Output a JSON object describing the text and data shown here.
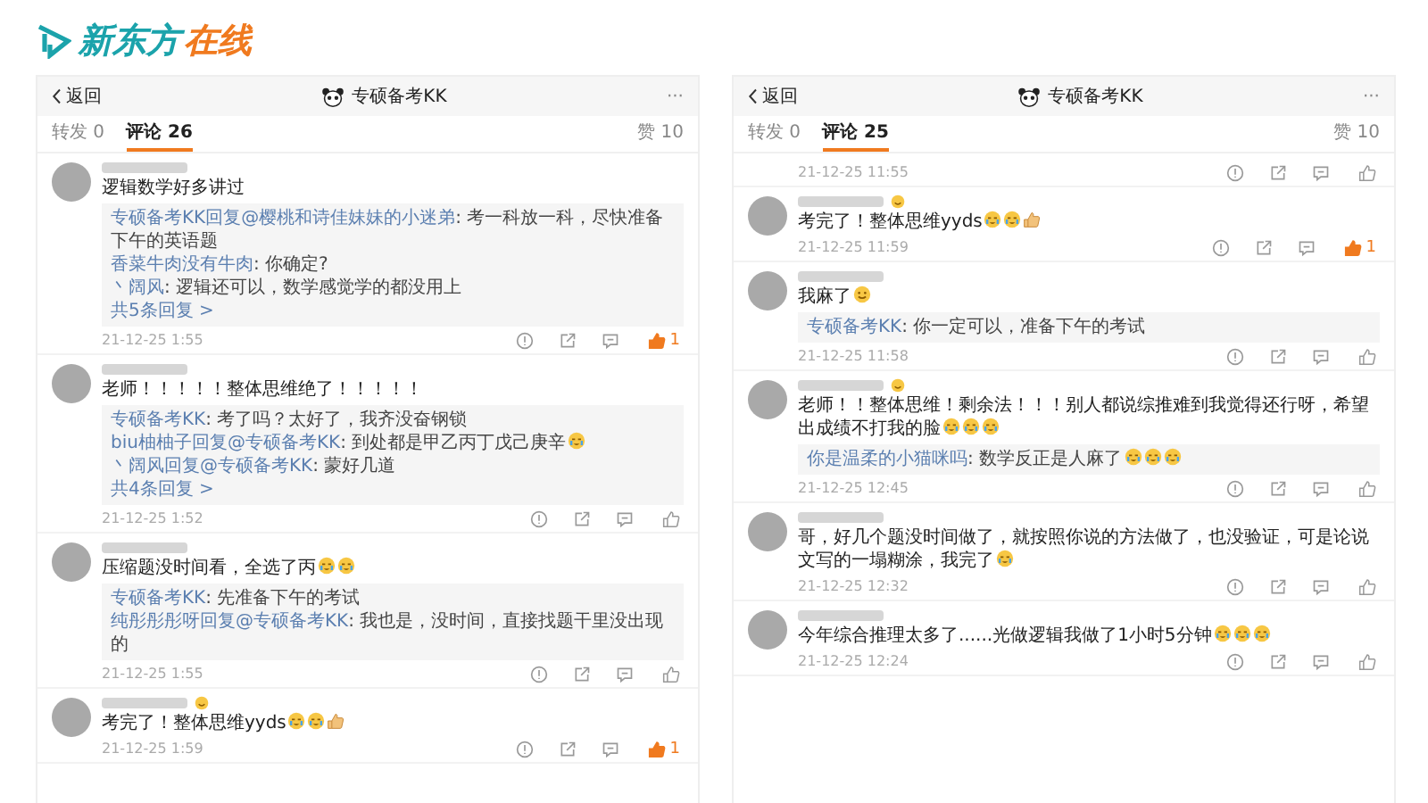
{
  "logo": {
    "parts": [
      {
        "text": "新东方",
        "color": "#1ba3ab"
      },
      {
        "text": "在线",
        "color": "#f07a1f"
      }
    ]
  },
  "phones": [
    {
      "back": "返回",
      "title": "专硕备考KK",
      "more": "···",
      "tabs": [
        {
          "label": "转发",
          "count": "0",
          "selected": false
        },
        {
          "label": "评论",
          "count": "26",
          "selected": true
        },
        {
          "label": "赞",
          "count": "10",
          "selected": false
        }
      ],
      "comments": [
        {
          "text": "逻辑数学好多讲过",
          "replies": [
            {
              "author": "专硕备考KK回复@樱桃和诗佳妹妹的小迷弟",
              "text": ": 考一科放一科，尽快准备下午的英语题"
            },
            {
              "author": "香菜牛肉没有牛肉",
              "text": ": 你确定?"
            },
            {
              "author": "丶阔风",
              "text": ": 逻辑还可以，数学感觉学的都没用上"
            }
          ],
          "more_replies": "共5条回复 >",
          "time": "21-12-25 1:55",
          "liked": true,
          "likes": "1"
        },
        {
          "text": "老师！！！！！整体思维绝了！！！！！",
          "replies": [
            {
              "author": "专硕备考KK",
              "text": ": 考了吗？太好了，我齐没奋钢锁"
            },
            {
              "author": "biu柚柚子回复@专硕备考KK",
              "text": ": 到处都是甲乙丙丁戊己庚辛",
              "emojis": [
                {
                  "kind": "cry"
                }
              ]
            },
            {
              "author": "丶阔风回复@专硕备考KK",
              "text": ": 蒙好几道"
            }
          ],
          "more_replies": "共4条回复 >",
          "time": "21-12-25 1:52",
          "liked": false
        },
        {
          "text": "压缩题没时间看，全选了丙",
          "emojis": [
            {
              "kind": "cry"
            },
            {
              "kind": "cry"
            }
          ],
          "replies": [
            {
              "author": "专硕备考KK",
              "text": ": 先准备下午的考试"
            },
            {
              "author": "纯彤彤彤呀回复@专硕备考KK",
              "text": ": 我也是，没时间，直接找题干里没出现的"
            }
          ],
          "time": "21-12-25 1:55",
          "liked": false
        },
        {
          "name_badge": true,
          "text": "考完了！整体思维yyds",
          "emojis": [
            {
              "kind": "cry"
            },
            {
              "kind": "cry"
            },
            {
              "kind": "thumb"
            }
          ],
          "time": "21-12-25 1:59",
          "liked": true,
          "likes": "1"
        }
      ]
    },
    {
      "back": "返回",
      "title": "专硕备考KK",
      "more": "···",
      "tabs": [
        {
          "label": "转发",
          "count": "0",
          "selected": false
        },
        {
          "label": "评论",
          "count": "25",
          "selected": true
        },
        {
          "label": "赞",
          "count": "10",
          "selected": false
        }
      ],
      "comments": [
        {
          "time": "21-12-25 11:55",
          "liked": false
        },
        {
          "name_badge": true,
          "text": "考完了！整体思维yyds",
          "emojis": [
            {
              "kind": "cry"
            },
            {
              "kind": "cry"
            },
            {
              "kind": "thumb"
            }
          ],
          "time": "21-12-25 11:59",
          "liked": true,
          "likes": "1"
        },
        {
          "text": "我麻了",
          "emojis": [
            {
              "kind": "smile"
            }
          ],
          "replies": [
            {
              "author": "专硕备考KK",
              "text": ": 你一定可以，准备下午的考试"
            }
          ],
          "time": "21-12-25 11:58",
          "liked": false
        },
        {
          "name_badge": true,
          "text": "老师！！整体思维！剩余法！！！别人都说综推难到我觉得还行呀，希望出成绩不打我的脸",
          "emojis": [
            {
              "kind": "cry"
            },
            {
              "kind": "cry"
            },
            {
              "kind": "cry"
            }
          ],
          "replies": [
            {
              "author": "你是温柔的小猫咪吗",
              "text": ": 数学反正是人麻了",
              "emojis": [
                {
                  "kind": "cry"
                },
                {
                  "kind": "cry"
                },
                {
                  "kind": "cry"
                }
              ]
            }
          ],
          "time": "21-12-25 12:45",
          "liked": false
        },
        {
          "text": "哥，好几个题没时间做了，就按照你说的方法做了，也没验证，可是论说文写的一塌糊涂，我完了",
          "emojis": [
            {
              "kind": "cry"
            }
          ],
          "time": "21-12-25 12:32",
          "liked": false
        },
        {
          "text": "今年综合推理太多了......光做逻辑我做了1小时5分钟",
          "emojis": [
            {
              "kind": "cry"
            },
            {
              "kind": "cry"
            },
            {
              "kind": "cry"
            }
          ],
          "time": "21-12-25 12:24",
          "liked": false
        }
      ]
    }
  ]
}
